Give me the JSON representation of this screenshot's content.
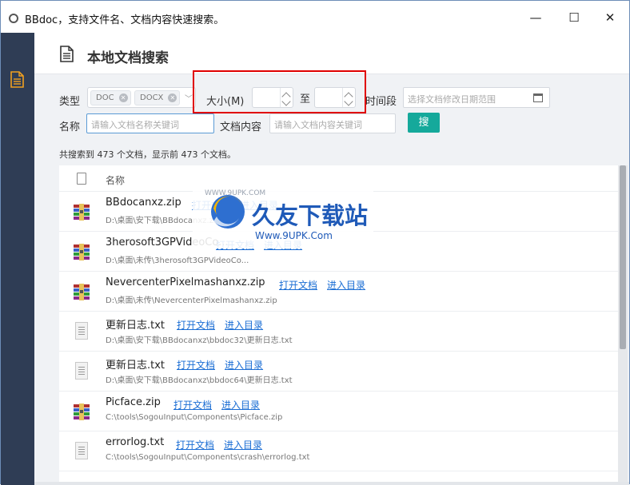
{
  "window": {
    "title": "BBdoc，支持文件名、文档内容快速搜索。",
    "minimize": "—",
    "maximize": "☐",
    "close": "✕"
  },
  "header": {
    "title": "本地文档搜索"
  },
  "filters": {
    "type_label": "类型",
    "tags": [
      "DOC",
      "DOCX"
    ],
    "size_label": "大小(M)",
    "size_to": "至",
    "time_label": "时间段",
    "date_placeholder": "选择文档修改日期范围",
    "name_label": "名称",
    "name_placeholder": "请输入文档名称关键词",
    "content_label": "文档内容",
    "content_placeholder": "请输入文档内容关键词",
    "search_button": "搜"
  },
  "summary": "共搜索到 473 个文档，显示前 473 个文档。",
  "list": {
    "column_name": "名称",
    "rows": [
      {
        "name": "BBdocanxz.zip",
        "type": "zip",
        "open": "打开文档",
        "dir": "进入目录",
        "path": "D:\\桌面\\安下载\\BBdocanxz.zip"
      },
      {
        "name": "3herosoft3GPVideoCo...",
        "type": "zip",
        "open": "打开文档",
        "dir": "进入目录",
        "path": "D:\\桌面\\未传\\3herosoft3GPVideoCo..."
      },
      {
        "name": "NevercenterPixelmashanxz.zip",
        "type": "zip",
        "open": "打开文档",
        "dir": "进入目录",
        "path": "D:\\桌面\\未传\\NevercenterPixelmashanxz.zip"
      },
      {
        "name": "更新日志.txt",
        "type": "txt",
        "open": "打开文档",
        "dir": "进入目录",
        "path": "D:\\桌面\\安下载\\BBdocanxz\\bbdoc32\\更新日志.txt"
      },
      {
        "name": "更新日志.txt",
        "type": "txt",
        "open": "打开文档",
        "dir": "进入目录",
        "path": "D:\\桌面\\安下载\\BBdocanxz\\bbdoc64\\更新日志.txt"
      },
      {
        "name": "Picface.zip",
        "type": "zip",
        "open": "打开文档",
        "dir": "进入目录",
        "path": "C:\\tools\\SogouInput\\Components\\Picface.zip"
      },
      {
        "name": "errorlog.txt",
        "type": "txt",
        "open": "打开文档",
        "dir": "进入目录",
        "path": "C:\\tools\\SogouInput\\Components\\crash\\errorlog.txt"
      }
    ]
  },
  "watermark": {
    "title": "久友下载站",
    "url": "Www.9UPK.Com",
    "tag": "9UPK.COM"
  }
}
